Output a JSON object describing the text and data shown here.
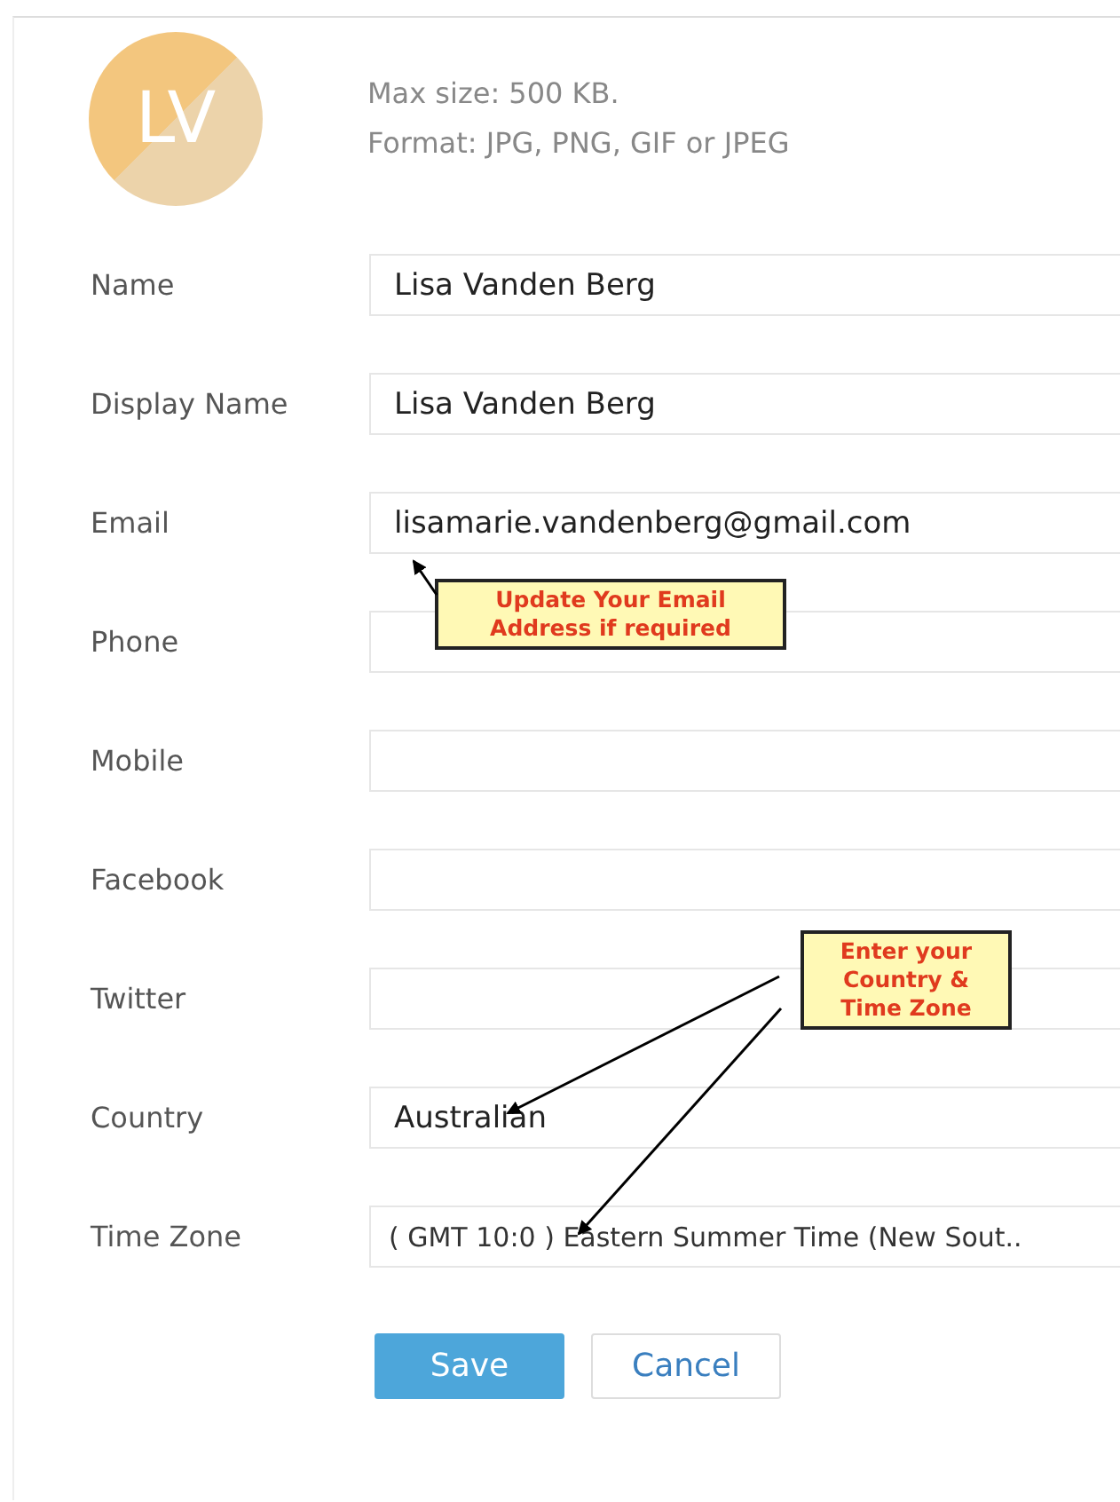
{
  "avatar": {
    "initials": "LV"
  },
  "upload_hints": [
    "Max size: 500 KB.",
    "Format: JPG, PNG, GIF or JPEG"
  ],
  "fields": [
    {
      "label": "Name",
      "value": "Lisa Vanden Berg"
    },
    {
      "label": "Display Name",
      "value": "Lisa Vanden Berg"
    },
    {
      "label": "Email",
      "value": "lisamarie.vandenberg@gmail.com"
    },
    {
      "label": "Phone"
    },
    {
      "label": "Mobile"
    },
    {
      "label": "Facebook"
    },
    {
      "label": "Twitter"
    },
    {
      "label": "Country",
      "value": "Australian"
    },
    {
      "label": "Time Zone",
      "value": "( GMT 10:0 ) Eastern Summer Time (New Sout.."
    }
  ],
  "callouts": [
    "Update Your Email Address if required",
    "Enter your Country & Time Zone"
  ],
  "buttons": [
    {
      "label": "Save",
      "kind": "primary"
    },
    {
      "label": "Cancel",
      "kind": "secondary"
    }
  ]
}
